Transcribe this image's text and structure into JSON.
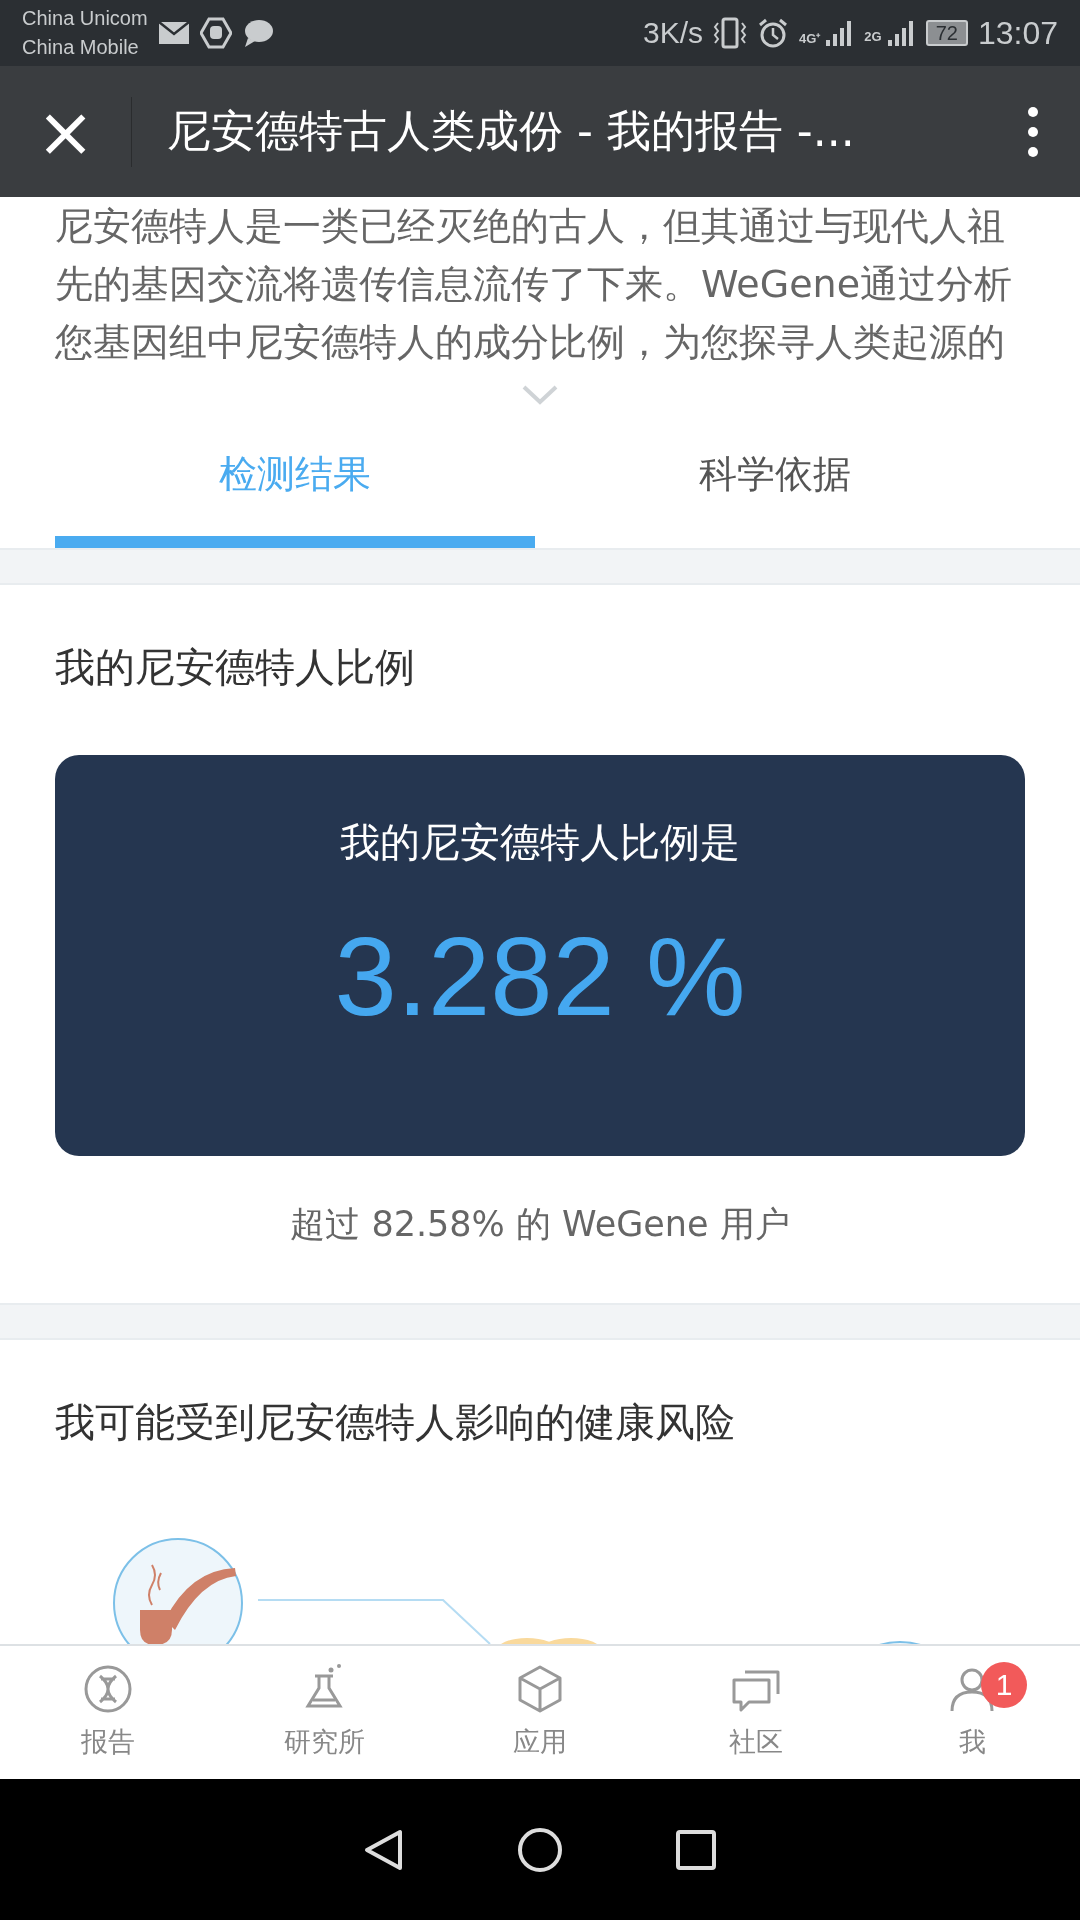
{
  "status_bar": {
    "carriers": [
      "China Unicom",
      "China Mobile"
    ],
    "speed": "3K/s",
    "network_4g": "4G⁺",
    "network_2g": "2G",
    "battery": "72",
    "time": "13:07"
  },
  "header": {
    "close": "×",
    "title": "尼安德特古人类成份 - 我的报告 -..."
  },
  "intro": {
    "text": "尼安德特人是一类已经灭绝的古人，但其通过与现代人祖先的基因交流将遗传信息流传了下来。WeGene通过分析您基因组中尼安德特人的成分比例，为您探寻人类起源的"
  },
  "tabs": [
    {
      "label": "检测结果",
      "selected": true
    },
    {
      "label": "科学依据",
      "selected": false
    }
  ],
  "ratio_section": {
    "title": "我的尼安德特人比例",
    "card_title": "我的尼安德特人比例是",
    "value": "3.282 %",
    "note": "超过 82.58% 的 WeGene 用户"
  },
  "risk_section": {
    "title": "我可能受到尼安德特人影响的健康风险"
  },
  "bottom_nav": [
    {
      "label": "报告",
      "kind": "dna"
    },
    {
      "label": "研究所",
      "kind": "flask"
    },
    {
      "label": "应用",
      "kind": "cube"
    },
    {
      "label": "社区",
      "kind": "chat"
    },
    {
      "label": "我",
      "kind": "person",
      "badge": "1"
    }
  ]
}
